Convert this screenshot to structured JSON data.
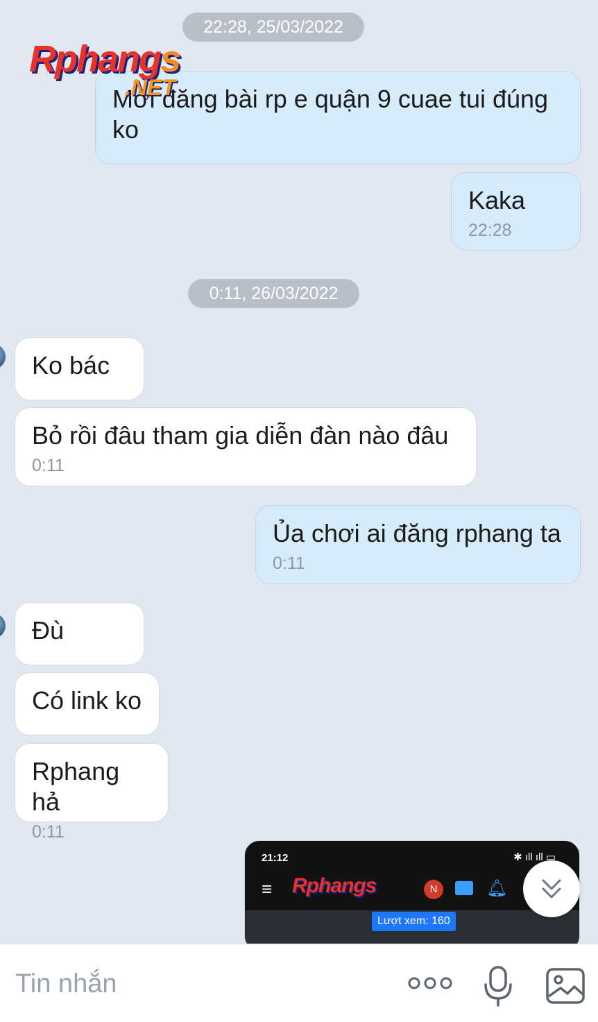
{
  "watermark": {
    "brand": "Rphangs",
    "suffix": ".NET"
  },
  "messages": {
    "date1": "22:28, 25/03/2022",
    "m1": "Mới đăng bài rp e quận 9 cuae tui đúng ko",
    "m2": "Kaka",
    "m2_time": "22:28",
    "date2": "0:11, 26/03/2022",
    "m3": "Ko bác",
    "m4": "Bỏ rồi đâu tham gia diễn đàn nào đâu",
    "m4_time": "0:11",
    "m5": "Ủa chơi ai đăng rphang ta",
    "m5_time": "0:11",
    "m6": "Đù",
    "m7": "Có link ko",
    "m8": "Rphang hả",
    "m8_time": "0:11"
  },
  "attachment": {
    "status_time": "21:12",
    "brand": "Rphangs",
    "badge": "N",
    "views": "Lượt xem: 160"
  },
  "composer": {
    "placeholder": "Tin nhắn"
  },
  "icons": {
    "more": "more-dots-icon",
    "mic": "mic-icon",
    "image": "image-icon",
    "scroll": "chevron-double-down-icon"
  },
  "colors": {
    "background": "#e2e8f0",
    "outgoing": "#d6ecfb",
    "incoming": "#ffffff",
    "date_pill": "#b9bfc6"
  }
}
